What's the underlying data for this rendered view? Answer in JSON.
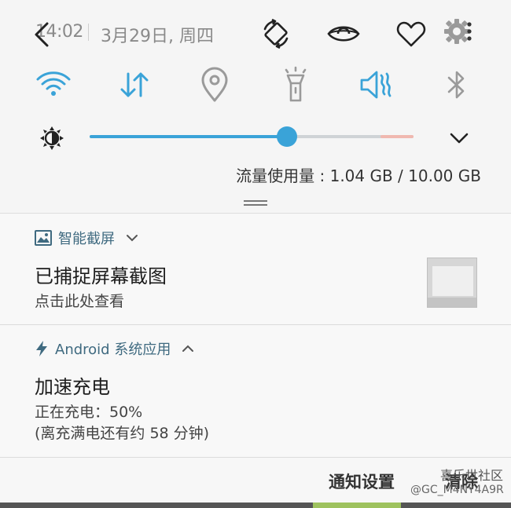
{
  "status_bar": {
    "time": "14:02",
    "date": "3月29日, 周四"
  },
  "icons": {
    "back": "back-arrow-icon",
    "rotate": "auto-rotate-icon",
    "eye": "eye-comfort-icon",
    "heart": "favorite-heart-icon",
    "settings": "settings-gear-icon"
  },
  "toggles": [
    {
      "icon": "wifi-icon",
      "active": true
    },
    {
      "icon": "mobile-data-icon",
      "active": true
    },
    {
      "icon": "location-icon",
      "active": false
    },
    {
      "icon": "flashlight-icon",
      "active": false
    },
    {
      "icon": "mute-icon",
      "active": true
    },
    {
      "icon": "bluetooth-icon",
      "active": false
    }
  ],
  "brightness": {
    "level_fraction": 0.61
  },
  "data_usage": "流量使用量 : 1.04 GB / 10.00 GB",
  "notifications": [
    {
      "app": "智能截屏",
      "title": "已捕捉屏幕截图",
      "text": "点击此处查看"
    },
    {
      "app": "Android 系统应用",
      "title": "加速充电",
      "text_line1": "正在充电：50%",
      "text_line2": "(离充满电还有约 58 分钟)"
    }
  ],
  "bottom_bar": {
    "settings_label": "通知设置",
    "clear_label": "清除"
  },
  "watermark": {
    "line1": "喜乐世社区",
    "line2": "@GC_M4NY4A9R"
  },
  "colors": {
    "accent": "#3aa3d8",
    "inactive_icon": "#9a9a9a",
    "app_name": "#3f6a80"
  }
}
